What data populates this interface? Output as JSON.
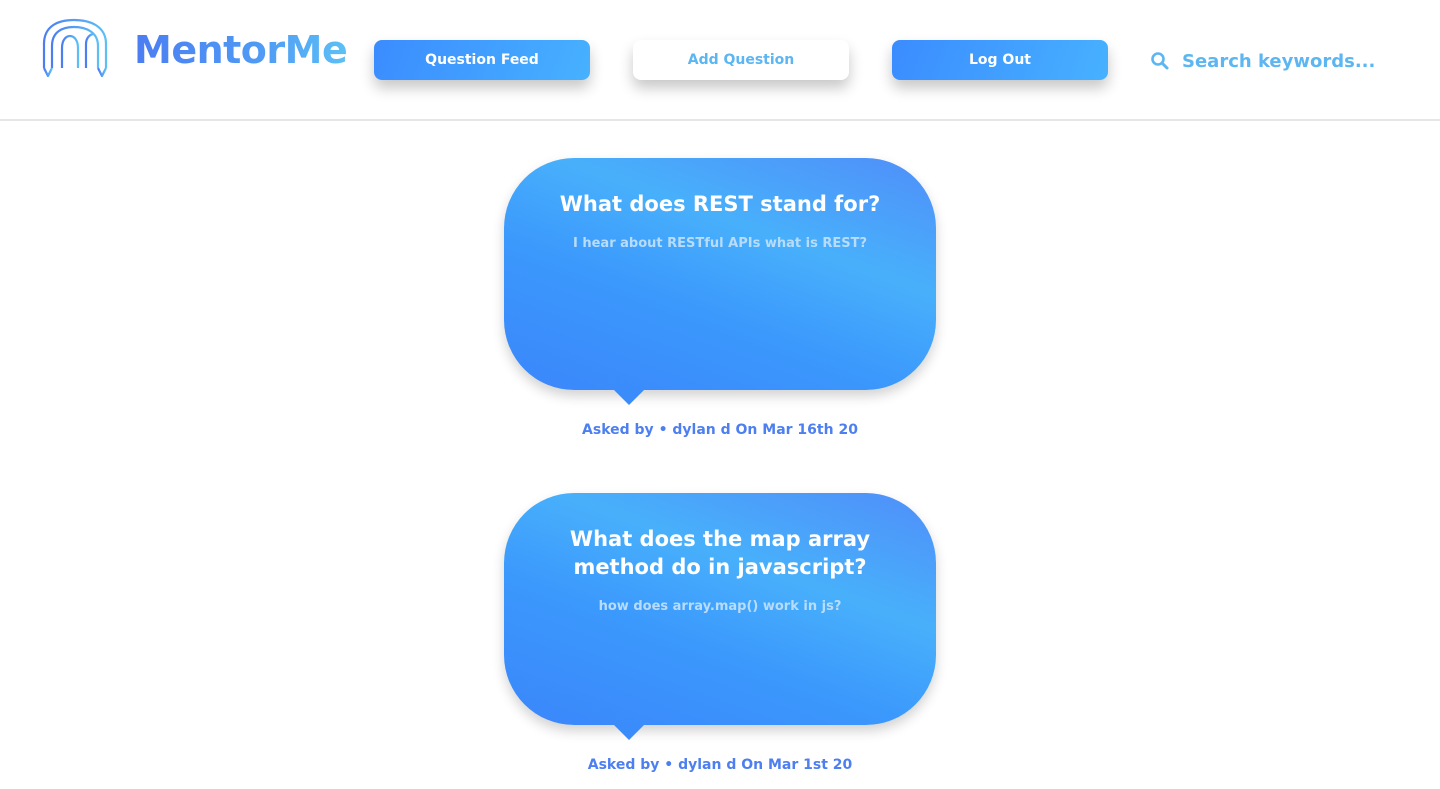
{
  "app": {
    "name": "MentorMe",
    "brand_colors": [
      "#4c7df2",
      "#5cc0f5"
    ]
  },
  "nav": {
    "question_feed_label": "Question Feed",
    "add_question_label": "Add Question",
    "log_out_label": "Log Out"
  },
  "search": {
    "icon": "search-icon",
    "placeholder": "Search keywords..."
  },
  "questions": [
    {
      "title": "What does REST stand for?",
      "body": "I hear about RESTful APIs what is REST?",
      "asked_prefix": "Asked by",
      "bullet": "•",
      "author": "dylan d",
      "date_text": "On Mar 16th 20"
    },
    {
      "title": "What does the map array method do in javascript?",
      "body": "how does array.map() work in js?",
      "asked_prefix": "Asked by",
      "bullet": "•",
      "author": "dylan d",
      "date_text": "On Mar 1st 20"
    }
  ]
}
